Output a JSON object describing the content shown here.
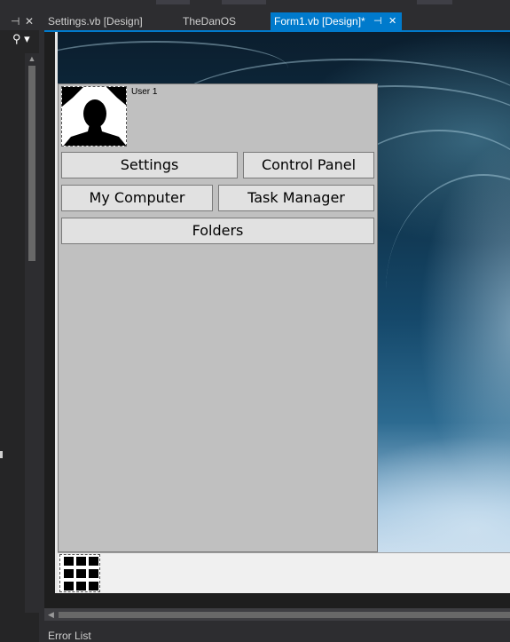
{
  "tabs": [
    {
      "label": "Settings.vb [Design]",
      "active": false
    },
    {
      "label": "TheDanOS",
      "active": false
    },
    {
      "label": "Form1.vb [Design]*",
      "active": true
    }
  ],
  "tab_controls": {
    "pin": "⊣",
    "close": "✕"
  },
  "panel_controls": {
    "pin": "⊣",
    "close": "✕",
    "search": "⚲ ▾"
  },
  "form": {
    "user_label": "User 1",
    "buttons": {
      "settings": "Settings",
      "control_panel": "Control Panel",
      "my_computer": "My Computer",
      "task_manager": "Task Manager",
      "folders": "Folders"
    }
  },
  "bottom_panel": {
    "title": "Error List"
  },
  "icons": {
    "avatar": "user-silhouette-icon",
    "start": "grid-icon",
    "scroll_left": "◀",
    "scroll_up": "▲"
  },
  "colors": {
    "accent": "#007acc",
    "ide_background": "#2d2d30",
    "menu_panel": "#c0c0c0"
  }
}
